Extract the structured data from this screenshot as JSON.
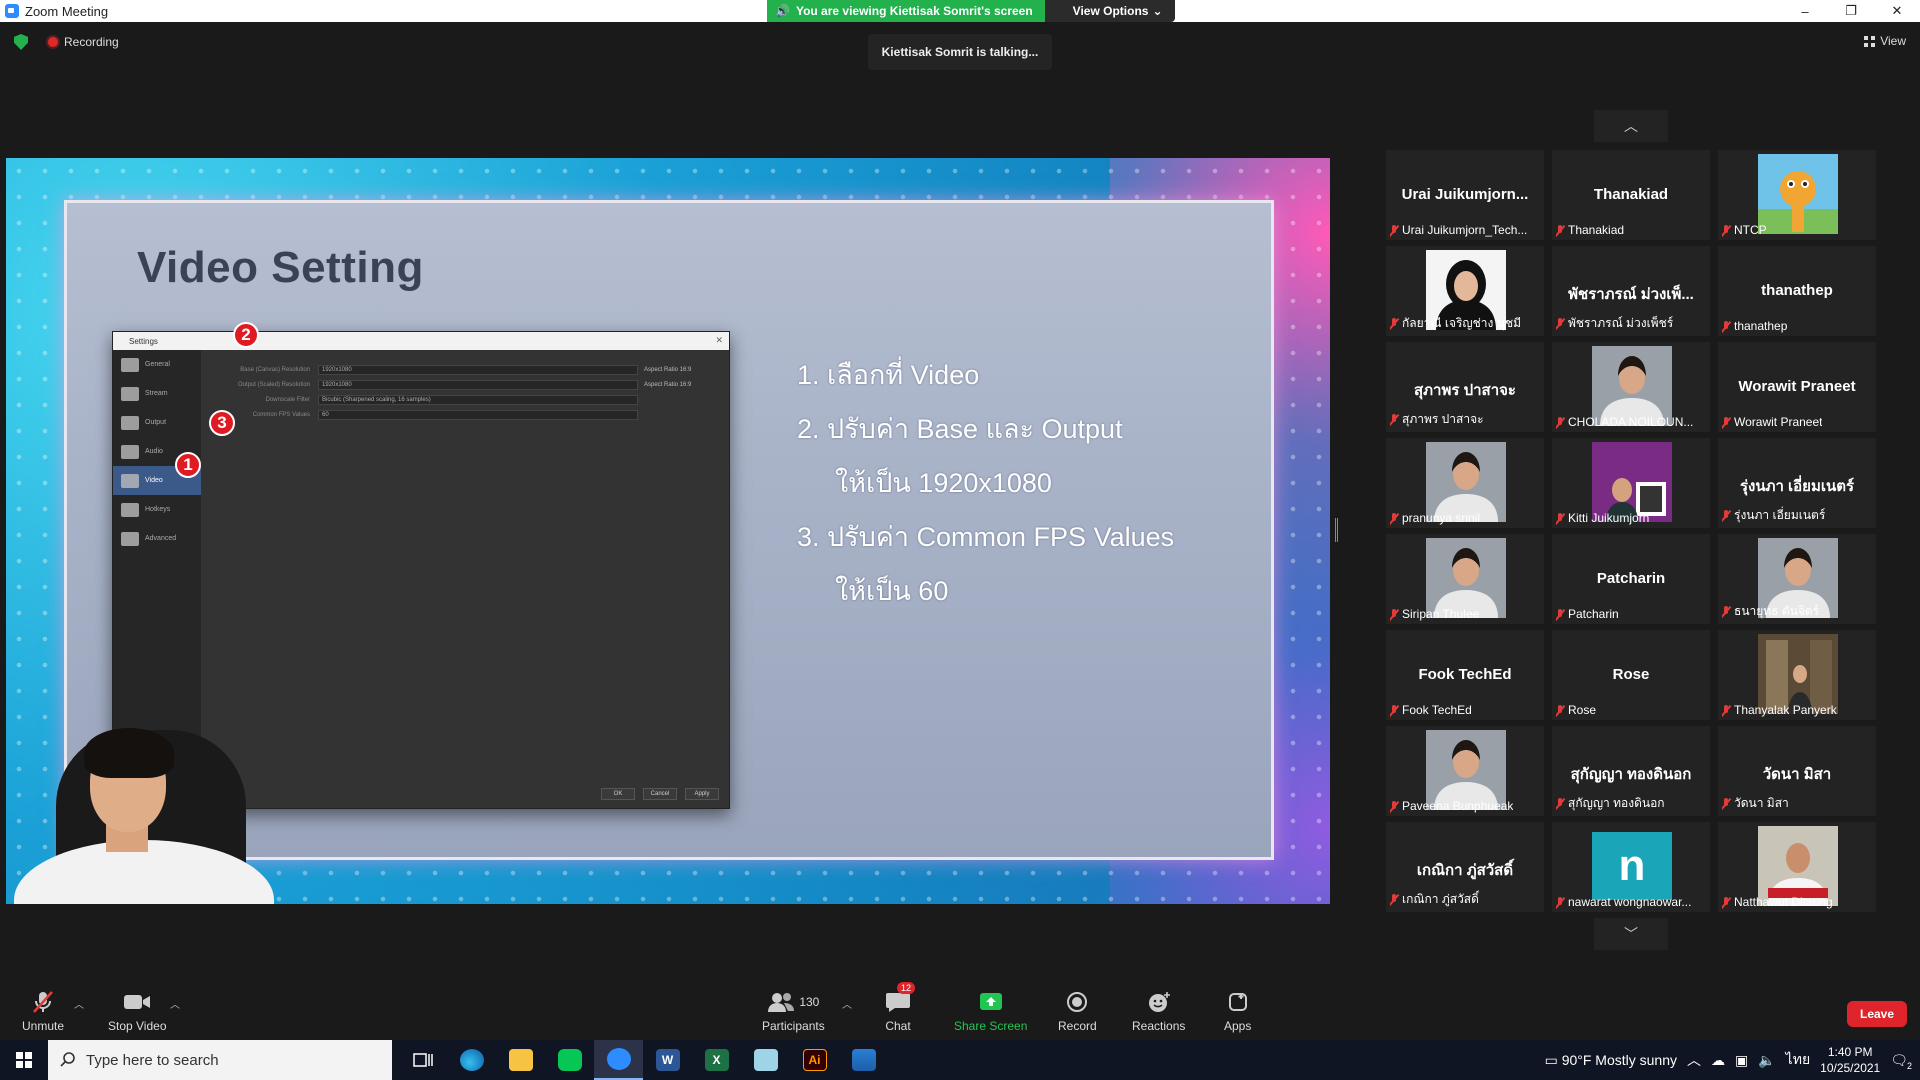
{
  "window": {
    "title": "Zoom Meeting",
    "viewing_banner": "You are viewing Kiettisak Somrit's screen",
    "view_options": "View Options",
    "minimize": "–",
    "restore": "❐",
    "close": "✕"
  },
  "status": {
    "recording": "Recording",
    "talking": "Kiettisak Somrit is talking...",
    "view": "View"
  },
  "slide": {
    "title": "Video Setting",
    "steps": [
      "1. เลือกที่ Video",
      "2. ปรับค่า Base และ Output",
      "ให้เป็น 1920x1080",
      "3. ปรับค่า Common FPS Values",
      "ให้เป็น 60"
    ],
    "obs": {
      "title": "Settings",
      "sidebar": [
        "General",
        "Stream",
        "Output",
        "Audio",
        "Video",
        "Hotkeys",
        "Advanced"
      ],
      "rows": [
        {
          "label": "Base (Canvas) Resolution",
          "value": "1920x1080",
          "aspect": "Aspect Ratio 16:9"
        },
        {
          "label": "Output (Scaled) Resolution",
          "value": "1920x1080",
          "aspect": "Aspect Ratio 16:9"
        },
        {
          "label": "Downscale Filter",
          "value": "Bicubic (Sharpened scaling, 16 samples)",
          "aspect": ""
        },
        {
          "label": "Common FPS Values",
          "value": "60",
          "aspect": ""
        }
      ],
      "buttons": [
        "OK",
        "Cancel",
        "Apply"
      ],
      "badges": [
        "1",
        "2",
        "3"
      ]
    }
  },
  "gallery": {
    "tiles": [
      {
        "name": "Urai  Juikumjorn...",
        "caption": "Urai Juikumjorn_Tech...",
        "pic": ""
      },
      {
        "name": "Thanakiad",
        "caption": "Thanakiad",
        "pic": ""
      },
      {
        "name": "",
        "caption": "NTCP",
        "pic": "giraffe"
      },
      {
        "name": "",
        "caption": "กัลยาณี เจริญช่าง นุชมี",
        "pic": "person-hijab"
      },
      {
        "name": "พัชราภรณ์ ม่วงเพ็...",
        "caption": "พัชราภรณ์ ม่วงเพ็ชร์",
        "pic": ""
      },
      {
        "name": "thanathep",
        "caption": "thanathep",
        "pic": ""
      },
      {
        "name": "สุภาพร ปาสาจะ",
        "caption": "สุภาพร ปาสาจะ",
        "pic": ""
      },
      {
        "name": "",
        "caption": "CHOLADA NOILOUN...",
        "pic": "person"
      },
      {
        "name": "Worawit Praneet",
        "caption": "Worawit Praneet",
        "pic": ""
      },
      {
        "name": "",
        "caption": "pranunya srinil",
        "pic": "person"
      },
      {
        "name": "",
        "caption": "Kitti Juikumjorn",
        "pic": "poster"
      },
      {
        "name": "รุ่งนภา เอี่ยมเนตร์",
        "caption": "รุ่งนภา เอี่ยมเนตร์",
        "pic": ""
      },
      {
        "name": "",
        "caption": "Siripan Thulee",
        "pic": "person"
      },
      {
        "name": "Patcharin",
        "caption": "Patcharin",
        "pic": ""
      },
      {
        "name": "",
        "caption": "ธนายุทธ ตันจิตร์",
        "pic": "person"
      },
      {
        "name": "Fook TechEd",
        "caption": "Fook TechEd",
        "pic": ""
      },
      {
        "name": "Rose",
        "caption": "Rose",
        "pic": ""
      },
      {
        "name": "",
        "caption": "Thanyalak Panyerk",
        "pic": "street"
      },
      {
        "name": "",
        "caption": "Paveena Bunphueak",
        "pic": "person"
      },
      {
        "name": "สุกัญญา ทองดินอก",
        "caption": "สุกัญญา ทองดินอก",
        "pic": ""
      },
      {
        "name": "วัดนา มิสา",
        "caption": "วัดนา มิสา",
        "pic": ""
      },
      {
        "name": "เกณิกา ภู่สวัสดิ์",
        "caption": "เกณิกา ภู่สวัสดิ์",
        "pic": ""
      },
      {
        "name": "",
        "caption": "nawarat wongnaowar...",
        "pic": "letter-n"
      },
      {
        "name": "",
        "caption": "Natthawut Ditaung",
        "pic": "person-red"
      }
    ],
    "letter_avatar": "n"
  },
  "toolbar": {
    "unmute": "Unmute",
    "stop_video": "Stop Video",
    "participants": "Participants",
    "participants_count": "130",
    "chat": "Chat",
    "chat_badge": "12",
    "share_screen": "Share Screen",
    "record": "Record",
    "reactions": "Reactions",
    "apps": "Apps",
    "leave": "Leave"
  },
  "taskbar": {
    "search_placeholder": "Type here to search",
    "weather": "90°F  Mostly sunny",
    "lang": "ไทย",
    "time": "1:40 PM",
    "date": "10/25/2021",
    "notif": "2"
  }
}
